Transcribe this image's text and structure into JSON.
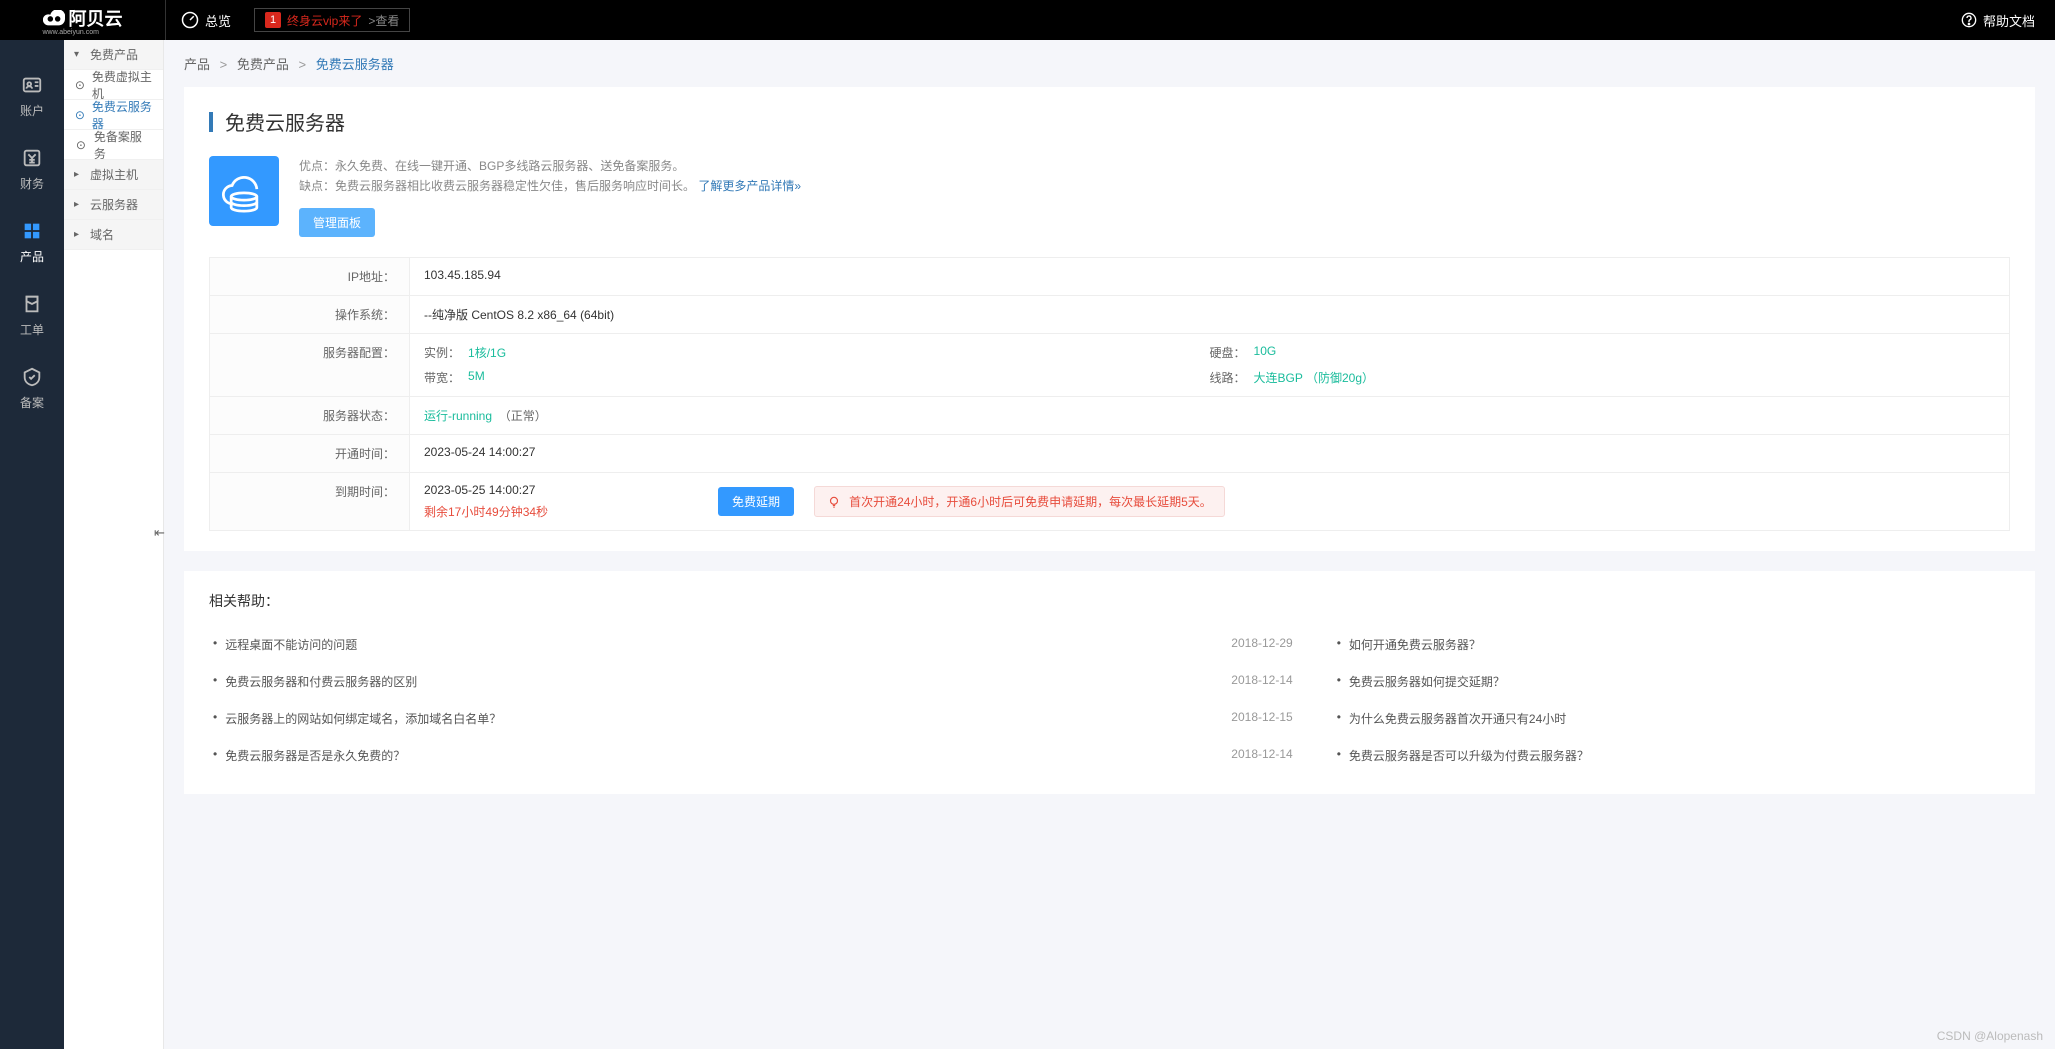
{
  "header": {
    "brand": "阿贝云",
    "brand_sub": "www.abeiyun.com",
    "overview": "总览",
    "vip_count": "1",
    "vip_text": "终身云vip来了",
    "vip_check": ">查看",
    "help_docs": "帮助文档"
  },
  "main_nav": [
    {
      "id": "account",
      "label": "账户"
    },
    {
      "id": "finance",
      "label": "财务"
    },
    {
      "id": "products",
      "label": "产品",
      "active": true
    },
    {
      "id": "tickets",
      "label": "工单"
    },
    {
      "id": "record",
      "label": "备案"
    }
  ],
  "sub_nav": [
    {
      "label": "免费产品",
      "type": "header",
      "chev": "▾"
    },
    {
      "label": "免费虚拟主机",
      "icon": "⊙"
    },
    {
      "label": "免费云服务器",
      "icon": "⊙",
      "active": true
    },
    {
      "label": "免备案服务",
      "icon": "⊙"
    },
    {
      "label": "虚拟主机",
      "type": "header",
      "chev": "▸"
    },
    {
      "label": "云服务器",
      "type": "header",
      "chev": "▸"
    },
    {
      "label": "域名",
      "type": "header",
      "chev": "▸"
    }
  ],
  "breadcrumb": {
    "home": "产品",
    "mid": "免费产品",
    "current": "免费云服务器"
  },
  "page": {
    "title": "免费云服务器",
    "advantages_label": "优点：",
    "advantages": "永久免费、在线一键开通、BGP多线路云服务器、送免备案服务。",
    "disadvantages_label": "缺点：",
    "disadvantages": "免费云服务器相比收费云服务器稳定性欠佳，售后服务响应时间长。",
    "learn_more": "了解更多产品详情»",
    "manage_btn": "管理面板"
  },
  "details": {
    "ip_label": "IP地址",
    "ip_value": "103.45.185.94",
    "os_label": "操作系统",
    "os_value": "--纯净版 CentOS 8.2 x86_64 (64bit)",
    "config_label": "服务器配置",
    "instance_label": "实例",
    "instance_value": "1核/1G",
    "bandwidth_label": "带宽",
    "bandwidth_value": "5M",
    "disk_label": "硬盘",
    "disk_value": "10G",
    "line_label": "线路",
    "line_value": "大连BGP （防御20g）",
    "status_label": "服务器状态",
    "status_value": "运行-running",
    "status_note": "（正常）",
    "open_time_label": "开通时间",
    "open_time_value": "2023-05-24 14:00:27",
    "expire_time_label": "到期时间",
    "expire_time_value": "2023-05-25 14:00:27",
    "remaining": "剩余17小时49分钟34秒",
    "renew_btn": "免费延期",
    "alert_text": "首次开通24小时，开通6小时后可免费申请延期，每次最长延期5天。"
  },
  "help": {
    "title": "相关帮助：",
    "left_items": [
      {
        "q": "远程桌面不能访问的问题",
        "date": "2018-12-29"
      },
      {
        "q": "免费云服务器和付费云服务器的区别",
        "date": "2018-12-14"
      },
      {
        "q": "云服务器上的网站如何绑定域名，添加域名白名单？",
        "date": "2018-12-15"
      },
      {
        "q": "免费云服务器是否是永久免费的？",
        "date": "2018-12-14"
      }
    ],
    "right_items": [
      {
        "q": "如何开通免费云服务器？"
      },
      {
        "q": "免费云服务器如何提交延期？"
      },
      {
        "q": "为什么免费云服务器首次开通只有24小时"
      },
      {
        "q": "免费云服务器是否可以升级为付费云服务器？"
      }
    ]
  },
  "watermark": "CSDN @Alopenash"
}
